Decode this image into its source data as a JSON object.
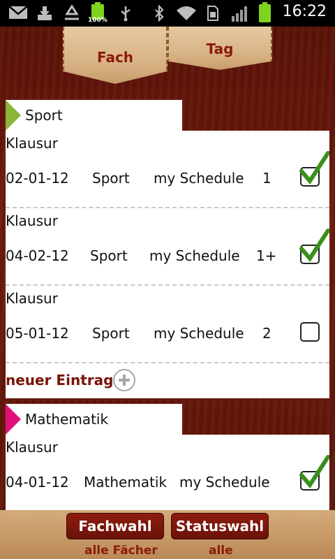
{
  "status_bar": {
    "time": "16:22",
    "battery_percent": "100%",
    "icons": [
      "gmail-icon",
      "download-icon",
      "recycle-icon",
      "battery-icon",
      "usb-icon",
      "bluetooth-icon",
      "wifi-icon",
      "sim-icon",
      "signal-icon",
      "battery-icon"
    ]
  },
  "tabs": [
    {
      "label": "Fach",
      "selected": true
    },
    {
      "label": "Tag",
      "selected": false
    }
  ],
  "sections": [
    {
      "title": "Sport",
      "color": "#8bb43a",
      "entries": [
        {
          "type": "Klausur",
          "date": "02-01-12",
          "subject": "Sport",
          "schedule": "my Schedule",
          "grade": "1",
          "checked": true
        },
        {
          "type": "Klausur",
          "date": "04-02-12",
          "subject": "Sport",
          "schedule": "my Schedule",
          "grade": "1+",
          "checked": true
        },
        {
          "type": "Klausur",
          "date": "05-01-12",
          "subject": "Sport",
          "schedule": "my Schedule",
          "grade": "2",
          "checked": false
        }
      ],
      "new_entry_label": "neuer Eintrag"
    },
    {
      "title": "Mathematik",
      "color": "#e0127a",
      "entries": [
        {
          "type": "Klausur",
          "date": "04-01-12",
          "subject": "Mathematik",
          "schedule": "my Schedule",
          "grade": "",
          "checked": true
        }
      ]
    }
  ],
  "bottom_bar": {
    "fachwahl_label": "Fachwahl",
    "fachwahl_value": "alle Fächer",
    "statuswahl_label": "Statuswahl",
    "statuswahl_value": "alle"
  }
}
